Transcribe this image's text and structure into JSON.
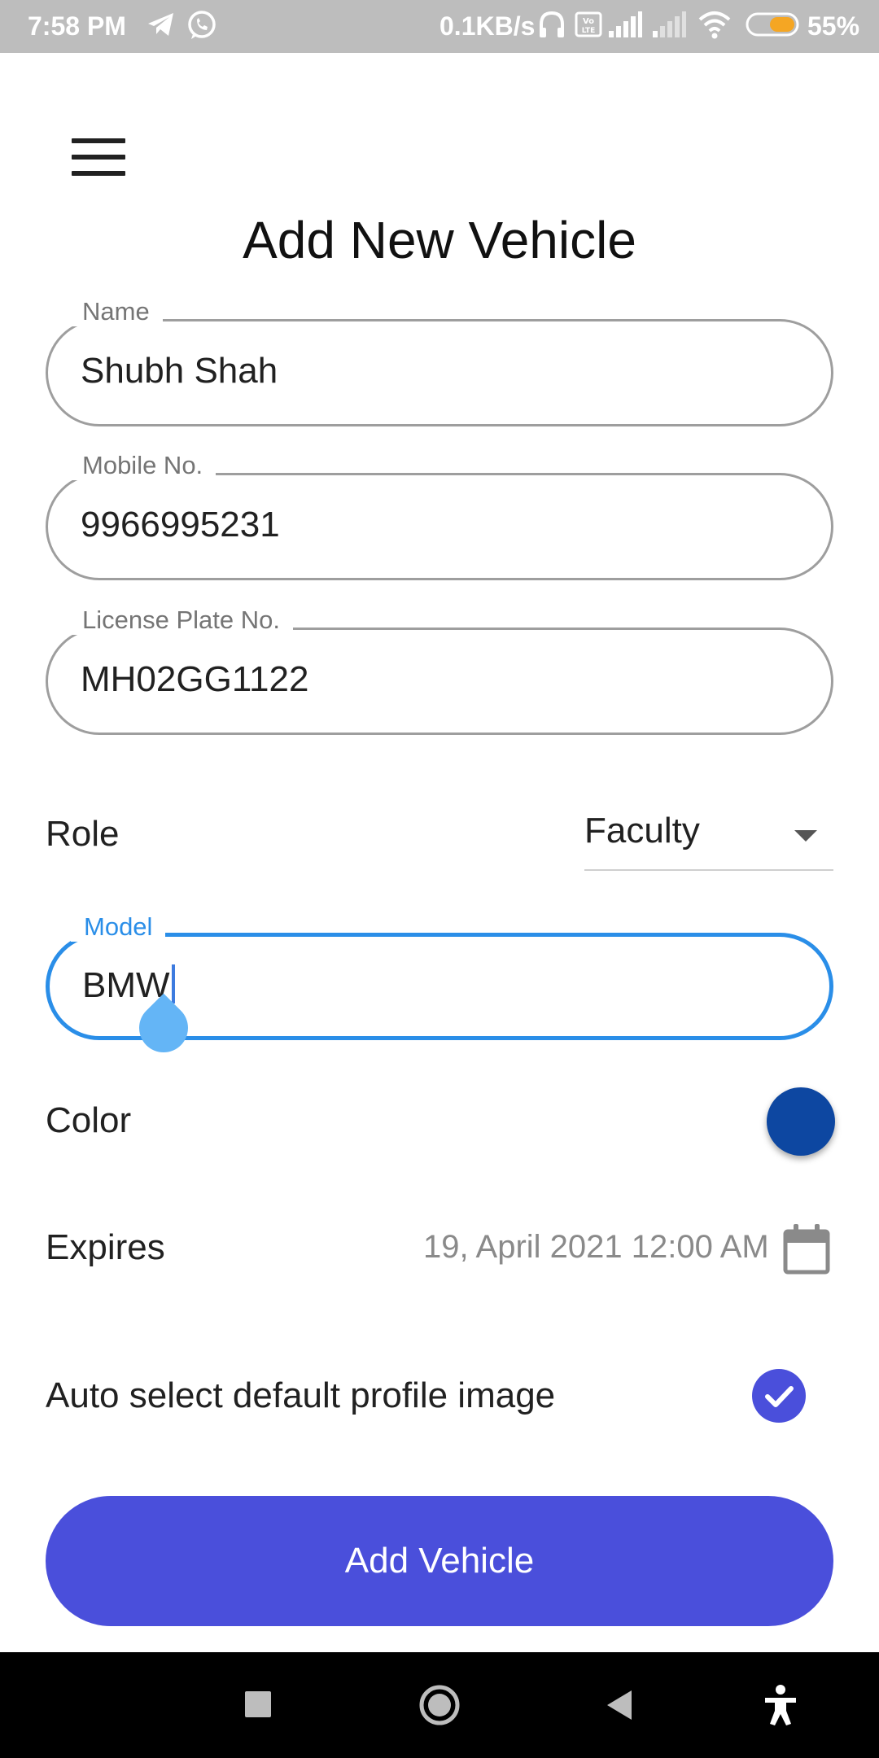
{
  "status_bar": {
    "time": "7:58 PM",
    "network_speed": "0.1KB/s",
    "battery_percent": "55%",
    "icons": [
      "telegram-icon",
      "whatsapp-icon",
      "headphones-icon",
      "volte-icon",
      "signal-icon",
      "signal-weak-icon",
      "wifi-icon",
      "battery-icon"
    ]
  },
  "header": {
    "menu_icon": "hamburger-menu-icon",
    "title": "Add New Vehicle"
  },
  "form": {
    "name": {
      "label": "Name",
      "value": "Shubh Shah"
    },
    "mobile": {
      "label": "Mobile No.",
      "value": "9966995231"
    },
    "license_plate": {
      "label": "License Plate No.",
      "value": "MH02GG1122"
    },
    "role": {
      "label": "Role",
      "selected": "Faculty"
    },
    "model": {
      "label": "Model",
      "value": "BMW"
    },
    "color": {
      "label": "Color",
      "swatch": "#0d47a1"
    },
    "expires": {
      "label": "Expires",
      "value": "19, April 2021 12:00 AM",
      "icon": "calendar-icon"
    },
    "auto_profile": {
      "label": "Auto select default profile image",
      "checked": true
    }
  },
  "actions": {
    "submit_label": "Add Vehicle"
  },
  "nav_bar": {
    "buttons": [
      "recents-icon",
      "home-icon",
      "back-icon",
      "accessibility-icon"
    ]
  },
  "colors": {
    "accent": "#2a8ee8",
    "primary_button": "#4a4fdb",
    "status_bar": "#bdbdbd"
  }
}
